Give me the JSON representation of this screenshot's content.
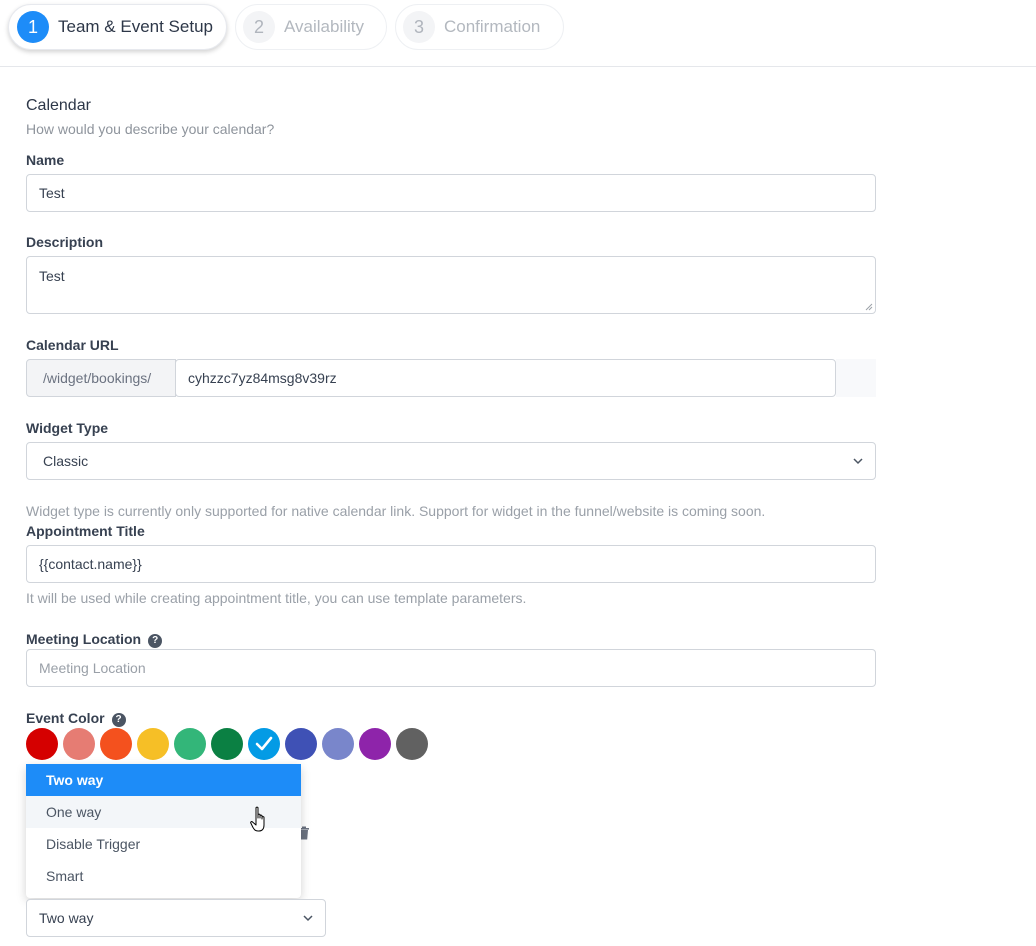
{
  "stepper": {
    "steps": [
      {
        "num": "1",
        "label": "Team & Event Setup"
      },
      {
        "num": "2",
        "label": "Availability"
      },
      {
        "num": "3",
        "label": "Confirmation"
      }
    ]
  },
  "section": {
    "title": "Calendar",
    "subtitle": "How would you describe your calendar?"
  },
  "form": {
    "name_label": "Name",
    "name_value": "Test",
    "description_label": "Description",
    "description_value": "Test",
    "url_label": "Calendar URL",
    "url_prefix": "/widget/bookings/",
    "url_value": "cyhzzc7yz84msg8v39rz",
    "widget_label": "Widget Type",
    "widget_value": "Classic",
    "widget_hint": "Widget type is currently only supported for native calendar link. Support for widget in the funnel/website is coming soon.",
    "appt_title_label": "Appointment Title",
    "appt_title_value": "{{contact.name}}",
    "appt_title_hint": "It will be used while creating appointment title, you can use template parameters.",
    "location_label": "Meeting Location",
    "location_placeholder": "Meeting Location",
    "event_color_label": "Event Color",
    "help_glyph": "?"
  },
  "colors": [
    "#d50000",
    "#e67c73",
    "#f4511e",
    "#f6bf26",
    "#33b679",
    "#0b8043",
    "#039be5",
    "#3f51b5",
    "#7986cb",
    "#8e24aa",
    "#616161"
  ],
  "selected_color_index": 6,
  "sync_dropdown": {
    "options": [
      "Two way",
      "One way",
      "Disable Trigger",
      "Smart"
    ],
    "selected": "Two way",
    "hovered": "One way",
    "current_value": "Two way"
  },
  "accent": "#1d8cf8"
}
